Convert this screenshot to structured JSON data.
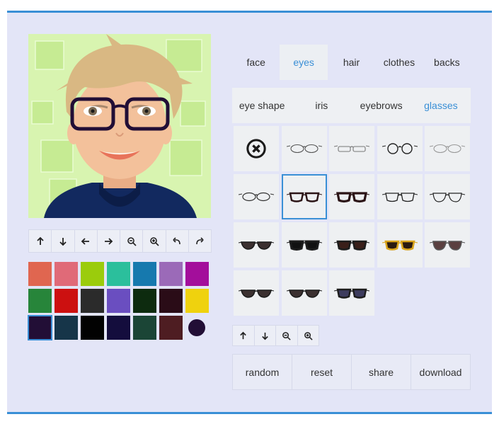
{
  "tabs": [
    {
      "label": "face",
      "active": false
    },
    {
      "label": "eyes",
      "active": true
    },
    {
      "label": "hair",
      "active": false
    },
    {
      "label": "clothes",
      "active": false
    },
    {
      "label": "backs",
      "active": false
    }
  ],
  "subtabs": [
    {
      "label": "eye shape",
      "active": false
    },
    {
      "label": "iris",
      "active": false
    },
    {
      "label": "eyebrows",
      "active": false
    },
    {
      "label": "glasses",
      "active": true
    }
  ],
  "avatar_tools": [
    "arrow-up-icon",
    "arrow-down-icon",
    "arrow-left-icon",
    "arrow-right-icon",
    "zoom-out-icon",
    "zoom-in-icon",
    "undo-icon",
    "redo-icon"
  ],
  "palette": {
    "rows": [
      [
        "#e06650",
        "#e06a78",
        "#9bcc0c",
        "#2bbf9c",
        "#1679ae",
        "#9b6ab8",
        "#a30e9b"
      ],
      [
        "#27853a",
        "#cc1010",
        "#2b2b2b",
        "#6a4ec0",
        "#0d2b0f",
        "#2a0c17",
        "#efd20e"
      ],
      [
        "#220e36",
        "#163549",
        "#020202",
        "#140d3d",
        "#1b4536",
        "#4e1d22"
      ]
    ],
    "selected_color": "#220e36",
    "current_color": "#220e36"
  },
  "glasses_options": [
    {
      "name": "no-glasses",
      "kind": "none"
    },
    {
      "name": "thin-oval",
      "kind": "wire"
    },
    {
      "name": "rimless-rect",
      "kind": "wire"
    },
    {
      "name": "round-wire",
      "kind": "wire"
    },
    {
      "name": "thin-gray-oval",
      "kind": "wire"
    },
    {
      "name": "oval-wire",
      "kind": "wire"
    },
    {
      "name": "dark-rect",
      "kind": "frame"
    },
    {
      "name": "bold-dark-rect",
      "kind": "frame"
    },
    {
      "name": "browline",
      "kind": "wire"
    },
    {
      "name": "aviator-clear",
      "kind": "wire"
    },
    {
      "name": "dark-shades",
      "kind": "shades"
    },
    {
      "name": "black-wayfarer",
      "kind": "shades"
    },
    {
      "name": "brown-shades",
      "kind": "shades"
    },
    {
      "name": "gold-shades",
      "kind": "shades"
    },
    {
      "name": "aviator-shades",
      "kind": "shades"
    },
    {
      "name": "smoke-shades",
      "kind": "shades"
    },
    {
      "name": "gray-shades",
      "kind": "shades"
    },
    {
      "name": "gradient-shades",
      "kind": "shades"
    }
  ],
  "selected_glasses": "dark-rect",
  "item_tools": [
    "arrow-up-icon",
    "arrow-down-icon",
    "zoom-out-icon",
    "zoom-in-icon"
  ],
  "actions": {
    "random": "random",
    "reset": "reset",
    "share": "share",
    "download": "download"
  },
  "colors": {
    "accent": "#3a8fd6",
    "panel": "#e3e5f7",
    "skin": "#f3c19b",
    "hair": "#d9b883",
    "hoodie": "#12295f"
  }
}
